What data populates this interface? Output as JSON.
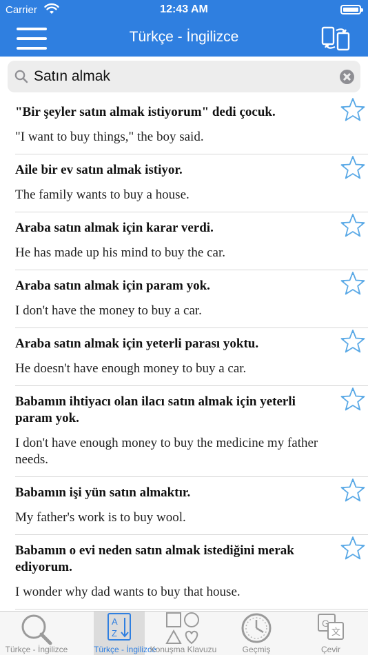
{
  "status_bar": {
    "carrier": "Carrier",
    "time": "12:43 AM"
  },
  "nav": {
    "title": "Türkçe - İngilizce"
  },
  "search": {
    "query": "Satın almak"
  },
  "results": [
    {
      "tr": "\"Bir şeyler satın almak istiyorum\" dedi çocuk.",
      "en": "\"I want to buy things,\" the boy said."
    },
    {
      "tr": "Aile bir ev satın almak istiyor.",
      "en": "The family wants to buy a house."
    },
    {
      "tr": "Araba satın almak için karar verdi.",
      "en": "He has made up his mind to buy the car."
    },
    {
      "tr": "Araba satın almak için param yok.",
      "en": "I don't have the money to buy a car."
    },
    {
      "tr": "Araba satın almak için yeterli parası yoktu.",
      "en": "He doesn't have enough money to buy a car."
    },
    {
      "tr": "Babamın ihtiyacı olan ilacı satın almak için yeterli param yok.",
      "en": "I don't have enough money to buy the medicine my father needs."
    },
    {
      "tr": "Babamın işi yün satın almaktır.",
      "en": "My father's work is to buy wool."
    },
    {
      "tr": "Babamın o evi neden satın almak istediğini merak ediyorum.",
      "en": "I wonder why dad wants to buy that house."
    }
  ],
  "tabs": [
    {
      "label": "Türkçe - İngilizce",
      "icon": "magnifier-icon",
      "active": false
    },
    {
      "label": "Türkçe - İngilizce",
      "icon": "az-sort-icon",
      "active": true
    },
    {
      "label": "Konuşma Klavuzu",
      "icon": "shapes-icon",
      "active": false
    },
    {
      "label": "Geçmiş",
      "icon": "history-clock-icon",
      "active": false
    },
    {
      "label": "Çevir",
      "icon": "translate-icon",
      "active": false
    }
  ],
  "colors": {
    "accent": "#2f7fe0",
    "tab_active_bg": "#dcdcdc",
    "star": "#5aa9e6"
  }
}
